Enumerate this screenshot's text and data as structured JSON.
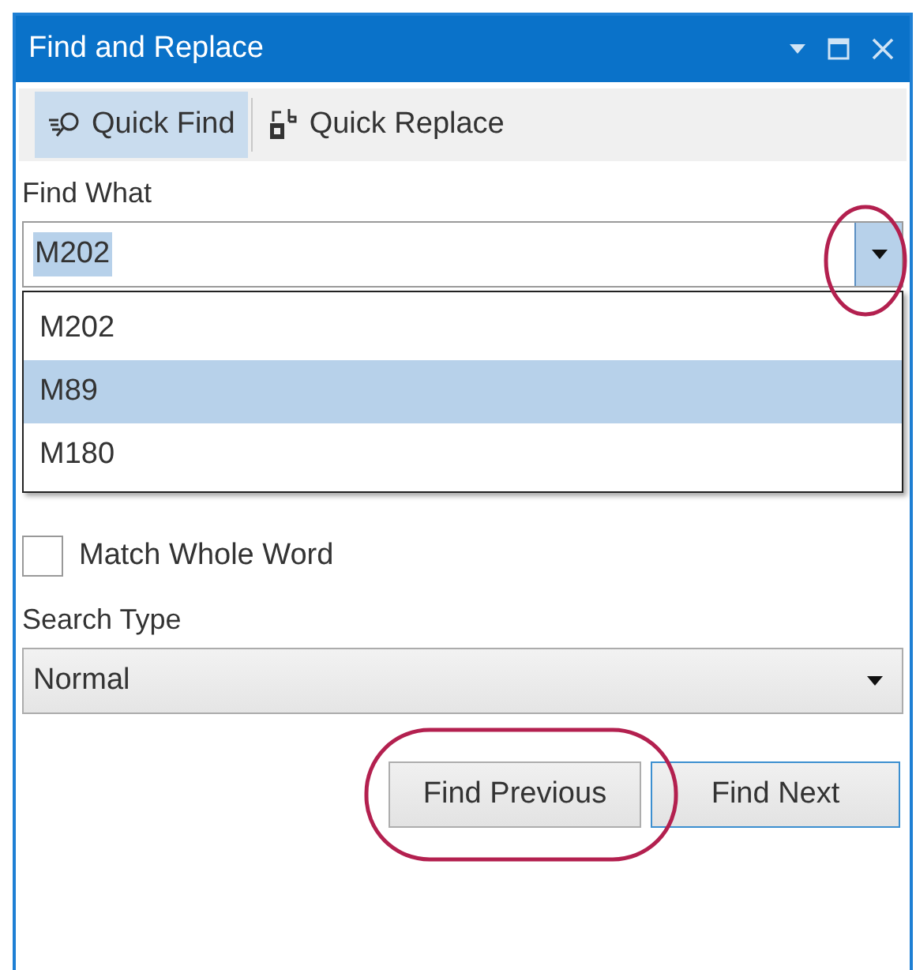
{
  "window": {
    "title": "Find and Replace"
  },
  "tabs": [
    {
      "label": "Quick Find",
      "kind": "find",
      "selected": true
    },
    {
      "label": "Quick Replace",
      "kind": "replace",
      "selected": false
    }
  ],
  "find_what": {
    "label": "Find What",
    "value": "M202",
    "expanded": true,
    "options": [
      {
        "label": "M202",
        "highlighted": false
      },
      {
        "label": "M89",
        "highlighted": true
      },
      {
        "label": "M180",
        "highlighted": false
      }
    ]
  },
  "options": [
    {
      "label": "Match Whole Word",
      "checked": false
    }
  ],
  "search_type": {
    "label": "Search Type",
    "value": "Normal"
  },
  "buttons": [
    {
      "label": "Find Previous",
      "focused": false
    },
    {
      "label": "Find Next",
      "focused": true
    }
  ]
}
